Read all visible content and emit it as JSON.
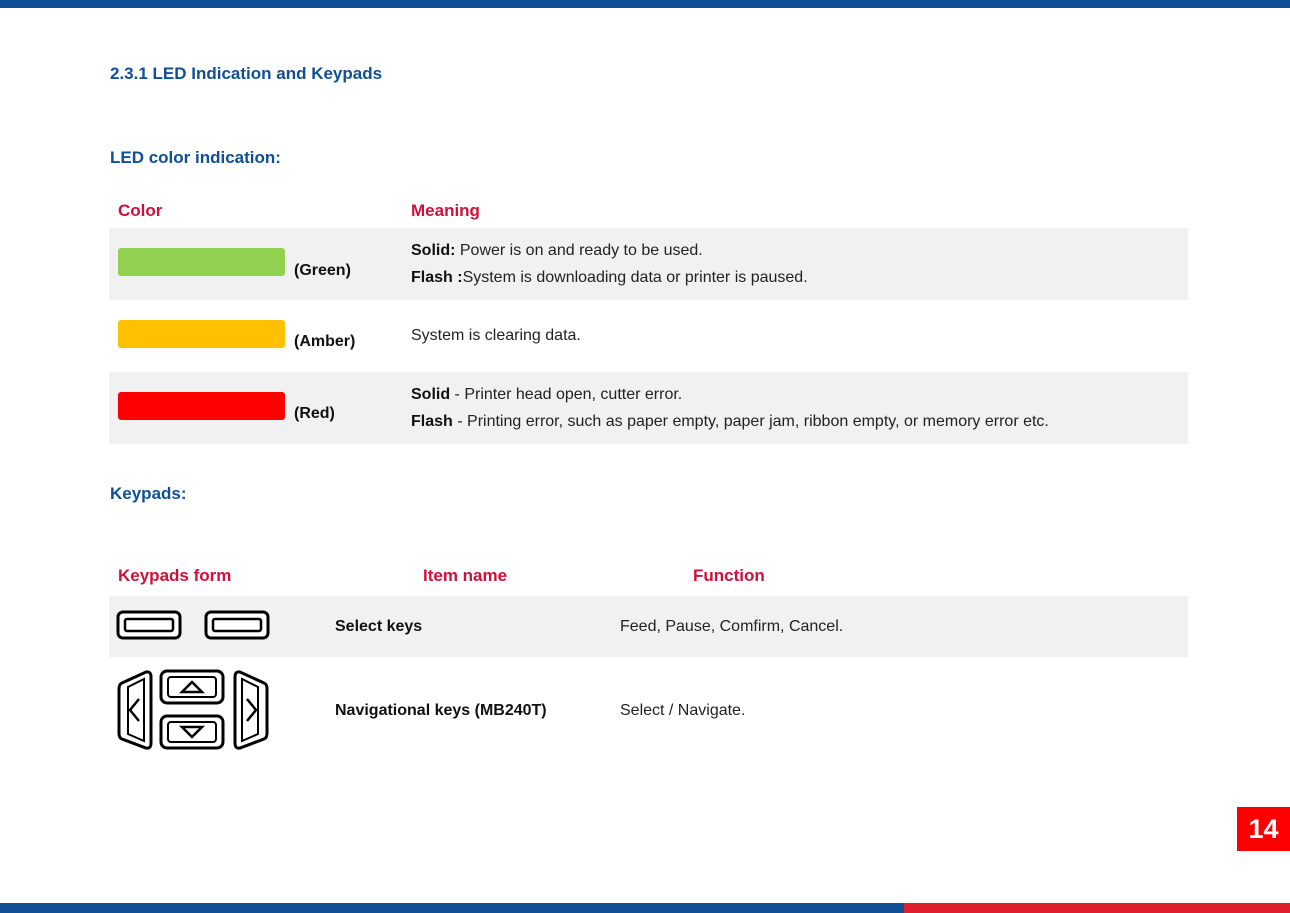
{
  "section_title": "2.3.1 LED Indication and Keypads",
  "led": {
    "heading": "LED color indication:",
    "col_color": "Color",
    "col_meaning": "Meaning",
    "rows": [
      {
        "swatch_color": "#92d050",
        "label": "(Green)",
        "line1_bold": "Solid:",
        "line1_text": " Power is on and ready to be used.",
        "line2_bold": "Flash :",
        "line2_text": "System is downloading data or printer is paused."
      },
      {
        "swatch_color": "#ffc000",
        "label": "(Amber)",
        "line1_text": "System is clearing data."
      },
      {
        "swatch_color": "#ff0000",
        "label": "(Red)",
        "line1_bold": "Solid",
        "line1_text": " - Printer head open, cutter error.",
        "line2_bold": "Flash",
        "line2_text": " - Printing error, such as paper empty, paper jam, ribbon empty, or memory error etc."
      }
    ]
  },
  "keypads": {
    "heading": "Keypads:",
    "col_form": "Keypads form",
    "col_item": "Item name",
    "col_function": "Function",
    "rows": [
      {
        "item_name": "Select keys",
        "function": "Feed, Pause, Comfirm, Cancel.",
        "icon": "select-keys-icon"
      },
      {
        "item_name": "Navigational keys (MB240T)",
        "function": "Select / Navigate.",
        "icon": "navigation-keys-icon"
      }
    ]
  },
  "page_number": "14",
  "colors": {
    "accent_blue": "#0f4f96",
    "accent_red": "#d0103a",
    "row_grey": "#f1f1f1"
  }
}
